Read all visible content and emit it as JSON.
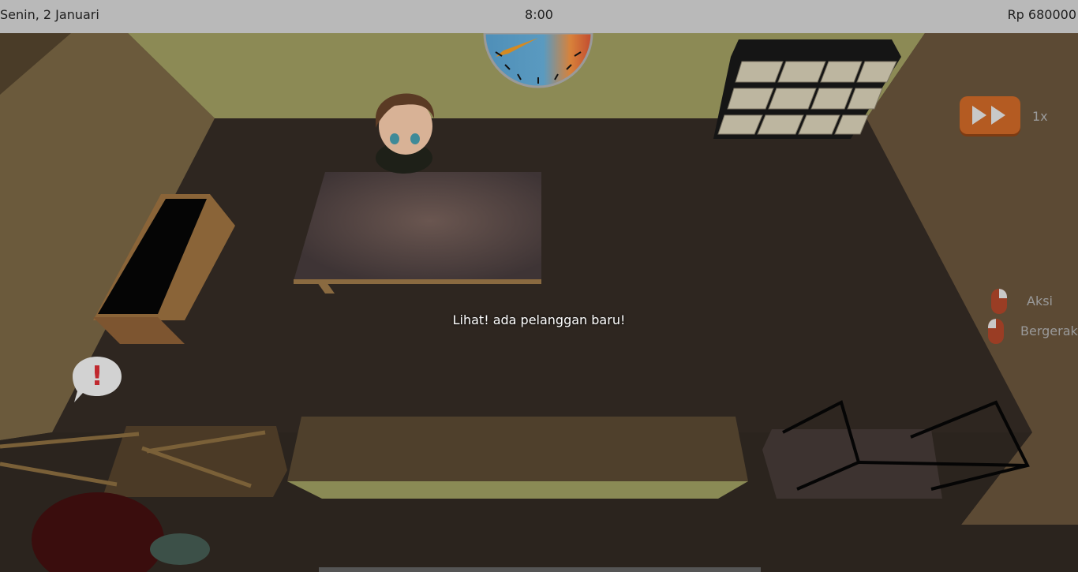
{
  "hud": {
    "date": "Senin, 2 Januari",
    "time": "8:00",
    "money": "Rp 680000"
  },
  "message": "Lihat! ada pelanggan baru!",
  "controls": {
    "speed": "1x",
    "mouse_action_label": "Aksi",
    "mouse_move_label": "Bergerak"
  },
  "alert_symbol": "!",
  "icons": [
    "fast-forward-icon",
    "left-click-icon",
    "right-click-icon",
    "exclamation-icon"
  ],
  "colors": {
    "hud_bar": "#b9b9b9",
    "accent_button": "#b45b22",
    "floor": "#2e2620",
    "wall": "#8c8a55"
  }
}
